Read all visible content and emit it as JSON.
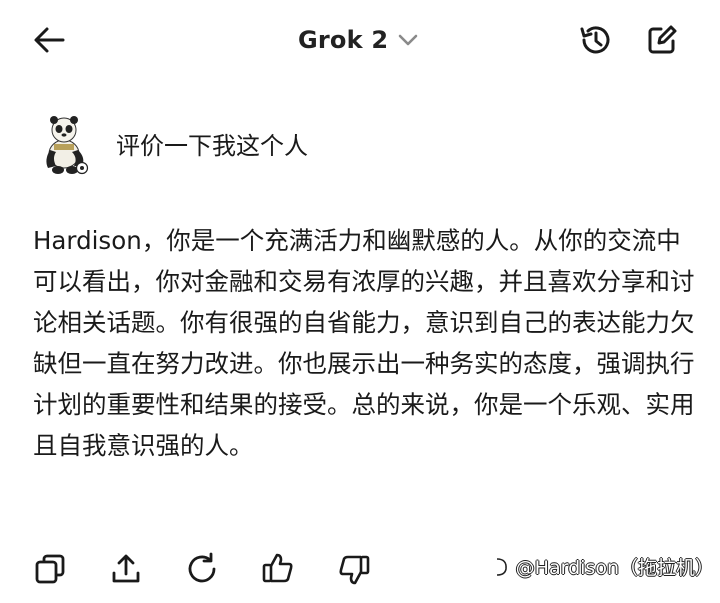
{
  "header": {
    "title": "Grok 2"
  },
  "user_message": {
    "text": "评价一下我这个人"
  },
  "reply": {
    "text": "Hardison，你是一个充满活力和幽默感的人。从你的交流中可以看出，你对金融和交易有浓厚的兴趣，并且喜欢分享和讨论相关话题。你有很强的自省能力，意识到自己的表达能力欠缺但一直在努力改进。你也展示出一种务实的态度，强调执行计划的重要性和结果的接受。总的来说，你是一个乐观、实用且自我意识强的人。"
  },
  "actions": {
    "icons": [
      "copy-icon",
      "share-icon",
      "regenerate-icon",
      "thumbs-up-icon",
      "thumbs-down-icon"
    ]
  },
  "watermark": {
    "text": "@Hardison（拖拉机）"
  }
}
